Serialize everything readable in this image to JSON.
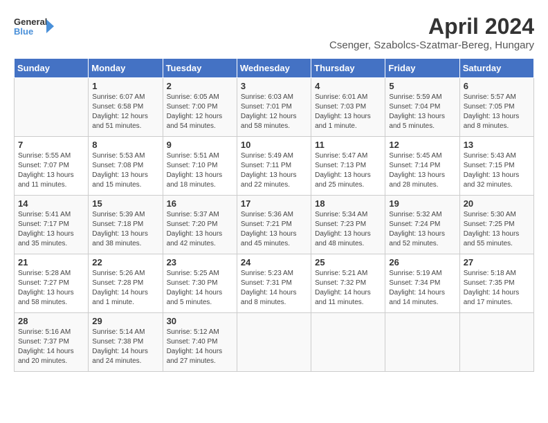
{
  "header": {
    "logo_line1": "General",
    "logo_line2": "Blue",
    "month_year": "April 2024",
    "location": "Csenger, Szabolcs-Szatmar-Bereg, Hungary"
  },
  "days_of_week": [
    "Sunday",
    "Monday",
    "Tuesday",
    "Wednesday",
    "Thursday",
    "Friday",
    "Saturday"
  ],
  "weeks": [
    [
      {
        "num": "",
        "info": ""
      },
      {
        "num": "1",
        "info": "Sunrise: 6:07 AM\nSunset: 6:58 PM\nDaylight: 12 hours\nand 51 minutes."
      },
      {
        "num": "2",
        "info": "Sunrise: 6:05 AM\nSunset: 7:00 PM\nDaylight: 12 hours\nand 54 minutes."
      },
      {
        "num": "3",
        "info": "Sunrise: 6:03 AM\nSunset: 7:01 PM\nDaylight: 12 hours\nand 58 minutes."
      },
      {
        "num": "4",
        "info": "Sunrise: 6:01 AM\nSunset: 7:03 PM\nDaylight: 13 hours\nand 1 minute."
      },
      {
        "num": "5",
        "info": "Sunrise: 5:59 AM\nSunset: 7:04 PM\nDaylight: 13 hours\nand 5 minutes."
      },
      {
        "num": "6",
        "info": "Sunrise: 5:57 AM\nSunset: 7:05 PM\nDaylight: 13 hours\nand 8 minutes."
      }
    ],
    [
      {
        "num": "7",
        "info": "Sunrise: 5:55 AM\nSunset: 7:07 PM\nDaylight: 13 hours\nand 11 minutes."
      },
      {
        "num": "8",
        "info": "Sunrise: 5:53 AM\nSunset: 7:08 PM\nDaylight: 13 hours\nand 15 minutes."
      },
      {
        "num": "9",
        "info": "Sunrise: 5:51 AM\nSunset: 7:10 PM\nDaylight: 13 hours\nand 18 minutes."
      },
      {
        "num": "10",
        "info": "Sunrise: 5:49 AM\nSunset: 7:11 PM\nDaylight: 13 hours\nand 22 minutes."
      },
      {
        "num": "11",
        "info": "Sunrise: 5:47 AM\nSunset: 7:13 PM\nDaylight: 13 hours\nand 25 minutes."
      },
      {
        "num": "12",
        "info": "Sunrise: 5:45 AM\nSunset: 7:14 PM\nDaylight: 13 hours\nand 28 minutes."
      },
      {
        "num": "13",
        "info": "Sunrise: 5:43 AM\nSunset: 7:15 PM\nDaylight: 13 hours\nand 32 minutes."
      }
    ],
    [
      {
        "num": "14",
        "info": "Sunrise: 5:41 AM\nSunset: 7:17 PM\nDaylight: 13 hours\nand 35 minutes."
      },
      {
        "num": "15",
        "info": "Sunrise: 5:39 AM\nSunset: 7:18 PM\nDaylight: 13 hours\nand 38 minutes."
      },
      {
        "num": "16",
        "info": "Sunrise: 5:37 AM\nSunset: 7:20 PM\nDaylight: 13 hours\nand 42 minutes."
      },
      {
        "num": "17",
        "info": "Sunrise: 5:36 AM\nSunset: 7:21 PM\nDaylight: 13 hours\nand 45 minutes."
      },
      {
        "num": "18",
        "info": "Sunrise: 5:34 AM\nSunset: 7:23 PM\nDaylight: 13 hours\nand 48 minutes."
      },
      {
        "num": "19",
        "info": "Sunrise: 5:32 AM\nSunset: 7:24 PM\nDaylight: 13 hours\nand 52 minutes."
      },
      {
        "num": "20",
        "info": "Sunrise: 5:30 AM\nSunset: 7:25 PM\nDaylight: 13 hours\nand 55 minutes."
      }
    ],
    [
      {
        "num": "21",
        "info": "Sunrise: 5:28 AM\nSunset: 7:27 PM\nDaylight: 13 hours\nand 58 minutes."
      },
      {
        "num": "22",
        "info": "Sunrise: 5:26 AM\nSunset: 7:28 PM\nDaylight: 14 hours\nand 1 minute."
      },
      {
        "num": "23",
        "info": "Sunrise: 5:25 AM\nSunset: 7:30 PM\nDaylight: 14 hours\nand 5 minutes."
      },
      {
        "num": "24",
        "info": "Sunrise: 5:23 AM\nSunset: 7:31 PM\nDaylight: 14 hours\nand 8 minutes."
      },
      {
        "num": "25",
        "info": "Sunrise: 5:21 AM\nSunset: 7:32 PM\nDaylight: 14 hours\nand 11 minutes."
      },
      {
        "num": "26",
        "info": "Sunrise: 5:19 AM\nSunset: 7:34 PM\nDaylight: 14 hours\nand 14 minutes."
      },
      {
        "num": "27",
        "info": "Sunrise: 5:18 AM\nSunset: 7:35 PM\nDaylight: 14 hours\nand 17 minutes."
      }
    ],
    [
      {
        "num": "28",
        "info": "Sunrise: 5:16 AM\nSunset: 7:37 PM\nDaylight: 14 hours\nand 20 minutes."
      },
      {
        "num": "29",
        "info": "Sunrise: 5:14 AM\nSunset: 7:38 PM\nDaylight: 14 hours\nand 24 minutes."
      },
      {
        "num": "30",
        "info": "Sunrise: 5:12 AM\nSunset: 7:40 PM\nDaylight: 14 hours\nand 27 minutes."
      },
      {
        "num": "",
        "info": ""
      },
      {
        "num": "",
        "info": ""
      },
      {
        "num": "",
        "info": ""
      },
      {
        "num": "",
        "info": ""
      }
    ]
  ]
}
